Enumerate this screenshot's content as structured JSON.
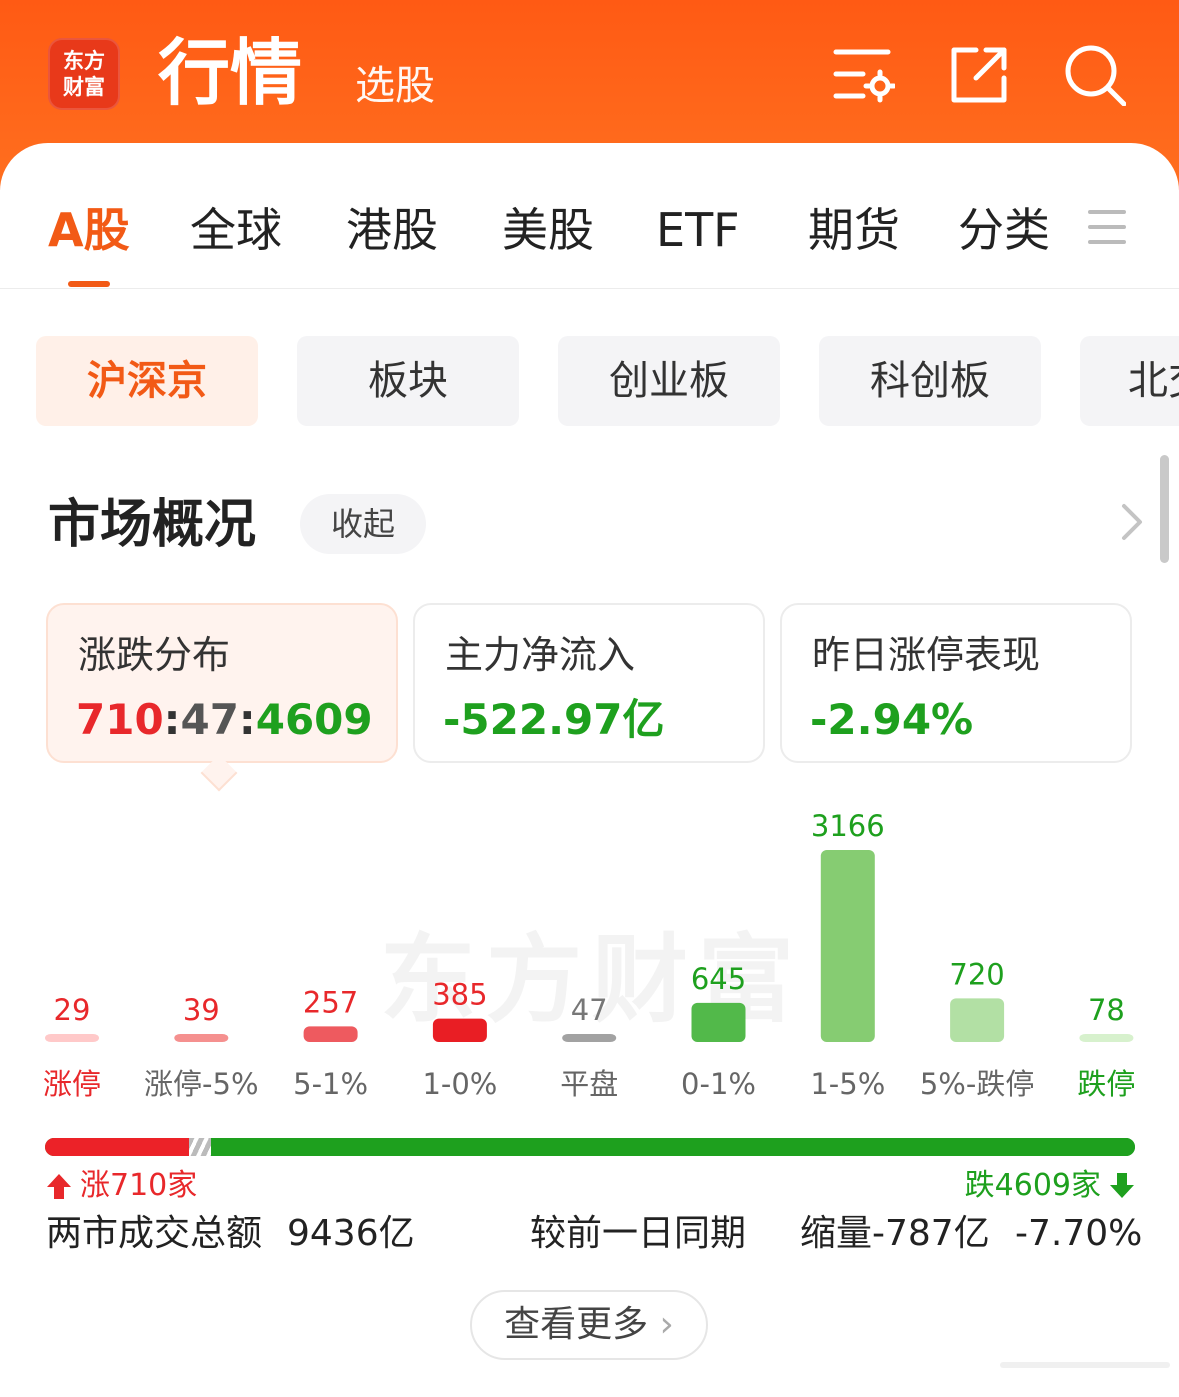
{
  "header": {
    "logo_line1": "东方",
    "logo_line2": "财富",
    "title": "行情",
    "subtitle": "选股",
    "icons": [
      "settings-list-icon",
      "share-icon",
      "search-icon"
    ]
  },
  "market_tabs": [
    {
      "label": "A股",
      "active": true
    },
    {
      "label": "全球",
      "active": false
    },
    {
      "label": "港股",
      "active": false
    },
    {
      "label": "美股",
      "active": false
    },
    {
      "label": "ETF",
      "active": false
    },
    {
      "label": "期货",
      "active": false
    },
    {
      "label": "分类",
      "active": false
    }
  ],
  "sub_tabs": [
    {
      "label": "沪深京",
      "active": true
    },
    {
      "label": "板块",
      "active": false
    },
    {
      "label": "创业板",
      "active": false
    },
    {
      "label": "科创板",
      "active": false
    },
    {
      "label": "北交",
      "active": false
    }
  ],
  "overview": {
    "title": "市场概况",
    "collapse_label": "收起"
  },
  "stats": [
    {
      "label": "涨跌分布",
      "value_up": "710",
      "value_flat": "47",
      "value_down": "4609",
      "active": true
    },
    {
      "label": "主力净流入",
      "value": "-522.97亿",
      "active": false
    },
    {
      "label": "昨日涨停表现",
      "value": "-2.94%",
      "active": false
    }
  ],
  "watermark": "东方财富",
  "chart_data": {
    "type": "bar",
    "categories": [
      "涨停",
      "涨停-5%",
      "5-1%",
      "1-0%",
      "平盘",
      "0-1%",
      "1-5%",
      "5%-跌停",
      "跌停"
    ],
    "values": [
      29,
      39,
      257,
      385,
      47,
      645,
      3166,
      720,
      78
    ],
    "bar_colors": [
      "#ffc9c9",
      "#f5908f",
      "#ee5a5f",
      "#e91e24",
      "#a2a2a2",
      "#52b94a",
      "#86cc72",
      "#b2e0a4",
      "#d7f1cd"
    ],
    "label_colors": [
      "#e8282b",
      "#e8282b",
      "#e8282b",
      "#e8282b",
      "#777777",
      "#1ea01e",
      "#1ea01e",
      "#1ea01e",
      "#1ea01e"
    ],
    "category_colors": [
      "#e8282b",
      "#666666",
      "#666666",
      "#666666",
      "#666666",
      "#666666",
      "#666666",
      "#666666",
      "#1ea01e"
    ]
  },
  "breadth": {
    "up_label": "涨710家",
    "down_label": "跌4609家",
    "up": 710,
    "flat": 47,
    "down": 4609
  },
  "volume": {
    "label": "两市成交总额",
    "value": "9436亿",
    "compare_label": "较前一日同期",
    "change": "缩量-787亿",
    "change_pct": "-7.70%"
  },
  "more_label": "查看更多"
}
